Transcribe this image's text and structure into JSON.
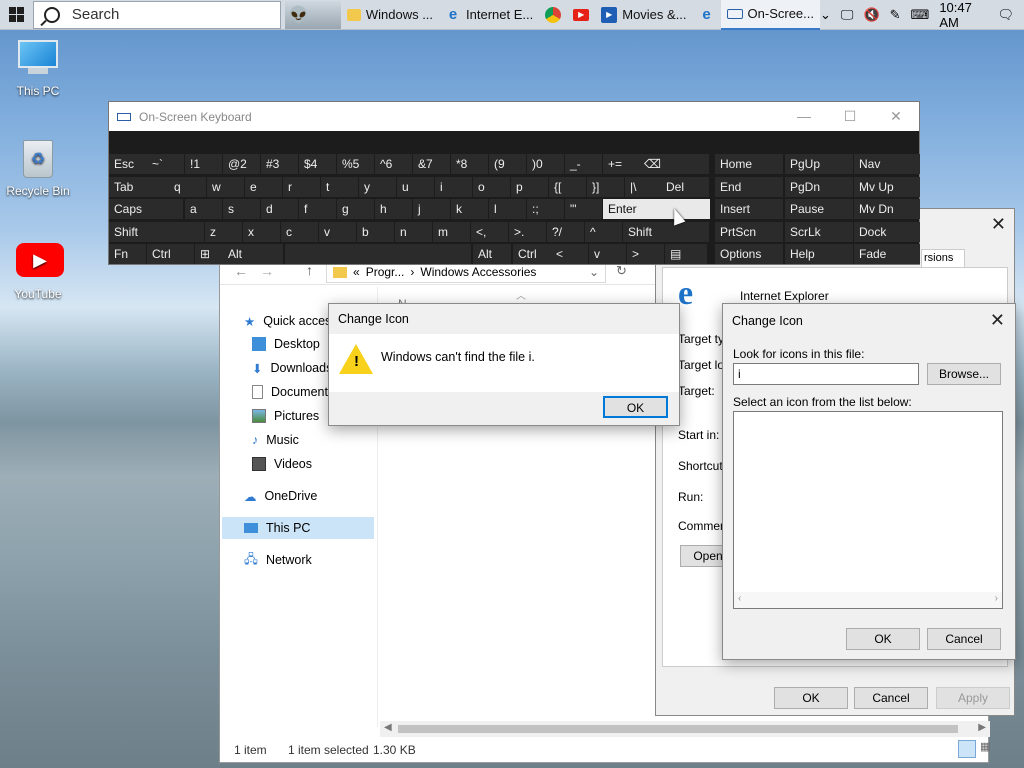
{
  "taskbar": {
    "search_placeholder": "Search",
    "apps": [
      {
        "label": "Windows ...",
        "icon": "folder-icon"
      },
      {
        "label": "Internet E...",
        "icon": "internet-explorer-icon"
      },
      {
        "label": "",
        "icon": "chrome-icon"
      },
      {
        "label": "",
        "icon": "youtube-icon"
      },
      {
        "label": "Movies &...",
        "icon": "movies-icon"
      },
      {
        "label": "",
        "icon": "edge-icon"
      },
      {
        "label": "On-Scree...",
        "icon": "keyboard-icon"
      }
    ],
    "clock": "10:47 AM"
  },
  "desktop": {
    "icons": [
      {
        "label": "This PC"
      },
      {
        "label": "Recycle Bin"
      },
      {
        "label": "YouTube"
      }
    ]
  },
  "osk": {
    "title": "On-Screen Keyboard",
    "rows": [
      [
        "Esc",
        "~`",
        "!1",
        "@2",
        "#3",
        "$4",
        "%5",
        "^6",
        "&7",
        "*8",
        "(9",
        ")0",
        "_-",
        "+=",
        "⌫",
        "Home",
        "PgUp",
        "Nav"
      ],
      [
        "Tab",
        "q",
        "w",
        "e",
        "r",
        "t",
        "y",
        "u",
        "i",
        "o",
        "p",
        "{[",
        "}]",
        "|\\",
        "Del",
        "End",
        "PgDn",
        "Mv Up"
      ],
      [
        "Caps",
        "a",
        "s",
        "d",
        "f",
        "g",
        "h",
        "j",
        "k",
        "l",
        ":;",
        "\"'",
        "Enter",
        "Insert",
        "Pause",
        "Mv Dn"
      ],
      [
        "Shift",
        "z",
        "x",
        "c",
        "v",
        "b",
        "n",
        "m",
        "<,",
        ">.",
        "?/",
        "^",
        "Shift",
        "PrtScn",
        "ScrLk",
        "Dock"
      ],
      [
        "Fn",
        "Ctrl",
        "⊞",
        "Alt",
        "",
        "Alt",
        "Ctrl",
        "<",
        "v",
        ">",
        "▤",
        "Options",
        "Help",
        "Fade"
      ]
    ]
  },
  "explorer": {
    "breadcrumb": [
      "«",
      "Progr...",
      "›",
      "Windows Accessories"
    ],
    "column_header": "N",
    "nav": [
      {
        "label": "Quick access",
        "icon": "star-icon"
      },
      {
        "label": "Desktop",
        "icon": "desktop-icon"
      },
      {
        "label": "Downloads",
        "icon": "download-icon"
      },
      {
        "label": "Documents",
        "icon": "document-icon"
      },
      {
        "label": "Pictures",
        "icon": "pictures-icon"
      },
      {
        "label": "Music",
        "icon": "music-icon"
      },
      {
        "label": "Videos",
        "icon": "videos-icon"
      },
      {
        "label": "OneDrive",
        "icon": "cloud-icon"
      },
      {
        "label": "This PC",
        "icon": "computer-icon"
      },
      {
        "label": "Network",
        "icon": "network-icon"
      }
    ],
    "status": {
      "count": "1 item",
      "selected": "1 item selected",
      "size": "1.30 KB"
    }
  },
  "properties": {
    "tab": "rsions",
    "app_name": "Internet Explorer",
    "labels": {
      "target_type": "Target typ",
      "target_location": "Target loc",
      "target": "Target:",
      "start_in": "Start in:",
      "shortcut_key": "Shortcut k",
      "run": "Run:",
      "comment": "Comment:"
    },
    "open_button": "Open",
    "buttons": {
      "ok": "OK",
      "cancel": "Cancel",
      "apply": "Apply"
    }
  },
  "error_dialog": {
    "title": "Change Icon",
    "message": "Windows can't find the file i.",
    "ok": "OK"
  },
  "change_icon_dialog": {
    "title": "Change Icon",
    "look_label": "Look for icons in this file:",
    "file_value": "i",
    "browse": "Browse...",
    "list_label": "Select an icon from the list below:",
    "ok": "OK",
    "cancel": "Cancel"
  },
  "colors": {
    "accent": "#0078d7",
    "selection": "#cce4f7",
    "osk_bg": "#1c1c1c",
    "osk_key": "#2b2b2b"
  }
}
